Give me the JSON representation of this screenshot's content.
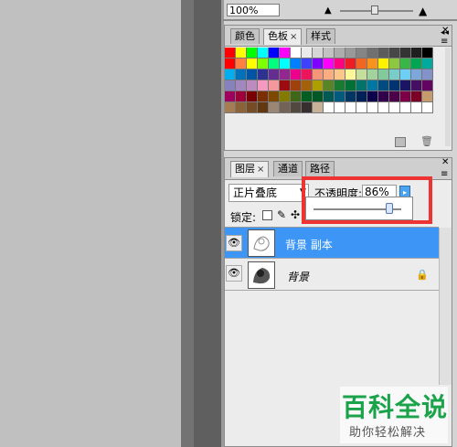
{
  "navigator": {
    "zoom": "100%"
  },
  "swatches_panel": {
    "tabs": [
      {
        "label": "颜色",
        "active": false,
        "closable": false
      },
      {
        "label": "色板",
        "active": true,
        "closable": true,
        "close_glyph": "×"
      },
      {
        "label": "样式",
        "active": false,
        "closable": false
      }
    ],
    "colors": [
      "#ff0000",
      "#ffff00",
      "#00ff00",
      "#00ffff",
      "#0000ff",
      "#ff00ff",
      "#ffffff",
      "#ebebeb",
      "#d6d6d6",
      "#c2c2c2",
      "#adadad",
      "#999999",
      "#858585",
      "#707070",
      "#5c5c5c",
      "#474747",
      "#333333",
      "#1f1f1f",
      "#000000",
      "#ff0000",
      "#ff8040",
      "#ffff00",
      "#80ff00",
      "#00ff80",
      "#00ffff",
      "#0080ff",
      "#4040ff",
      "#8000ff",
      "#ff00ff",
      "#ff0080",
      "#ee1c25",
      "#f26522",
      "#f7941d",
      "#fff200",
      "#8dc63f",
      "#39b54a",
      "#00a651",
      "#00a99d",
      "#00aeef",
      "#0072bc",
      "#0054a6",
      "#2e3192",
      "#662d91",
      "#92278f",
      "#ec008c",
      "#ed145b",
      "#f69679",
      "#f9ad81",
      "#fdc68a",
      "#fff799",
      "#c4df9b",
      "#a3d39c",
      "#82ca9c",
      "#7accc8",
      "#6dcff6",
      "#7da7d9",
      "#8393ca",
      "#8781bd",
      "#a187be",
      "#bd8cbf",
      "#f49ac1",
      "#f5989d",
      "#9e0b0f",
      "#a0410d",
      "#a3620a",
      "#aba000",
      "#598527",
      "#197b30",
      "#007236",
      "#00746b",
      "#0076a3",
      "#004b80",
      "#003471",
      "#1b1464",
      "#440e62",
      "#630460",
      "#9e005d",
      "#9e0039",
      "#790000",
      "#7b2e00",
      "#7d4900",
      "#827b00",
      "#406618",
      "#005e20",
      "#005826",
      "#005952",
      "#005b7f",
      "#003663",
      "#002157",
      "#0d004c",
      "#32004b",
      "#4b0049",
      "#7b0046",
      "#7a0026",
      "#c69c6d",
      "#a67c52",
      "#8c6239",
      "#754c24",
      "#603913",
      "#998675",
      "#736357",
      "#534741",
      "#362f2d",
      "#c7b299",
      "#ffffff",
      "#ffffff",
      "#ffffff",
      "#ffffff",
      "#ffffff",
      "#ffffff",
      "#ffffff",
      "#ffffff",
      "#ffffff",
      "#ffffff"
    ]
  },
  "layers_panel": {
    "tabs": [
      {
        "label": "图层",
        "active": true,
        "close_glyph": "×"
      },
      {
        "label": "通道",
        "active": false
      },
      {
        "label": "路径",
        "active": false
      }
    ],
    "blend_mode": "正片叠底",
    "opacity_label": "不透明度:",
    "opacity_value": "86%",
    "opacity_fraction": 0.86,
    "lock_label": "锁定:",
    "layers": [
      {
        "name": "背景 副本",
        "selected": true,
        "italic": false
      },
      {
        "name": "背景",
        "selected": false,
        "italic": true,
        "locked": true
      }
    ]
  },
  "watermark": {
    "title": "百科全说",
    "subtitle": "助你轻松解决"
  },
  "colors": {
    "selection": "#3d95f5",
    "highlight_box": "#ee3333",
    "watermark_green": "#1aa34a"
  }
}
